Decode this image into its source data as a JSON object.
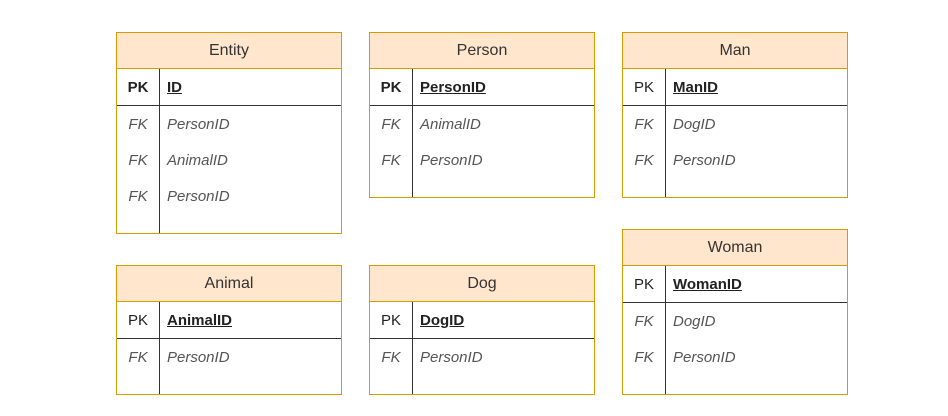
{
  "tables": {
    "entity": {
      "title": "Entity",
      "pk": {
        "key": "PK",
        "name": "ID"
      },
      "fks": [
        {
          "key": "FK",
          "name": "PersonID"
        },
        {
          "key": "FK",
          "name": "AnimalID"
        },
        {
          "key": "FK",
          "name": "PersonID"
        }
      ]
    },
    "person": {
      "title": "Person",
      "pk": {
        "key": "PK",
        "name": "PersonID"
      },
      "fks": [
        {
          "key": "FK",
          "name": "AnimalID"
        },
        {
          "key": "FK",
          "name": "PersonID"
        }
      ]
    },
    "man": {
      "title": "Man",
      "pk": {
        "key": "PK",
        "name": "ManID"
      },
      "fks": [
        {
          "key": "FK",
          "name": "DogID"
        },
        {
          "key": "FK",
          "name": "PersonID"
        }
      ]
    },
    "woman": {
      "title": "Woman",
      "pk": {
        "key": "PK",
        "name": "WomanID"
      },
      "fks": [
        {
          "key": "FK",
          "name": "DogID"
        },
        {
          "key": "FK",
          "name": "PersonID"
        }
      ]
    },
    "animal": {
      "title": "Animal",
      "pk": {
        "key": "PK",
        "name": "AnimalID"
      },
      "fks": [
        {
          "key": "FK",
          "name": "PersonID"
        }
      ]
    },
    "dog": {
      "title": "Dog",
      "pk": {
        "key": "PK",
        "name": "DogID"
      },
      "fks": [
        {
          "key": "FK",
          "name": "PersonID"
        }
      ]
    }
  },
  "colors": {
    "header_fill": "#ffe6cc",
    "border": "#d79b00"
  }
}
